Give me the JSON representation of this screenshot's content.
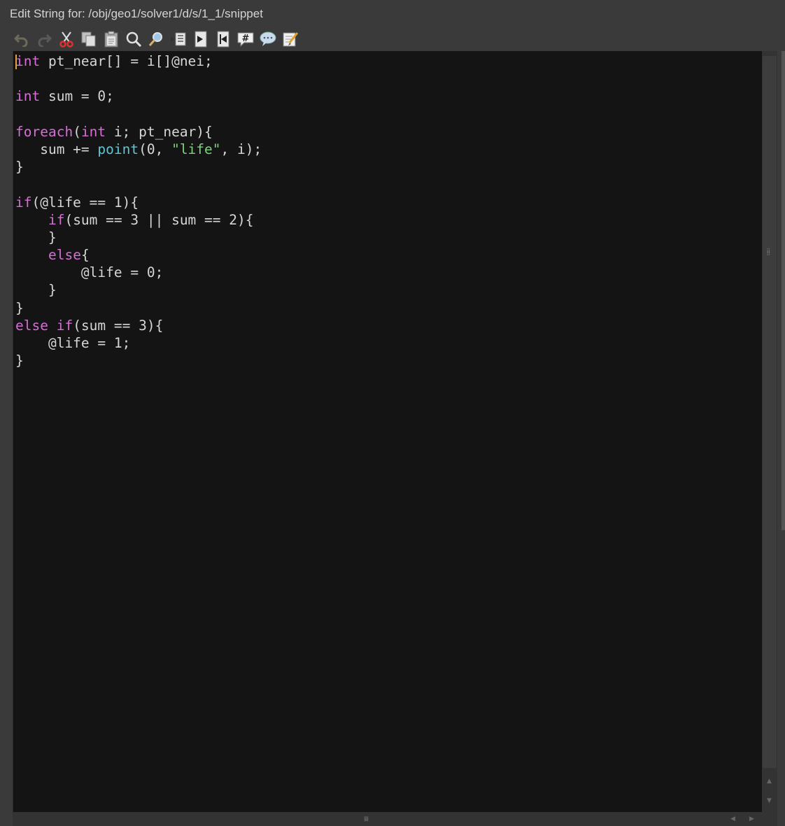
{
  "window": {
    "title": "Edit String for: /obj/geo1/solver1/d/s/1_1/snippet"
  },
  "toolbar": {
    "buttons": [
      {
        "name": "undo",
        "icon": "undo-icon"
      },
      {
        "name": "redo",
        "icon": "redo-icon"
      },
      {
        "name": "cut",
        "icon": "scissors-icon"
      },
      {
        "name": "copy",
        "icon": "copy-icon"
      },
      {
        "name": "paste",
        "icon": "paste-icon"
      },
      {
        "name": "find",
        "icon": "magnifier-icon"
      },
      {
        "name": "replace",
        "icon": "find-replace-icon"
      },
      {
        "name": "indent",
        "icon": "indent-icon"
      },
      {
        "name": "goto-next",
        "icon": "page-arrow-right-icon"
      },
      {
        "name": "goto-prev",
        "icon": "page-arrow-left-icon"
      },
      {
        "name": "comment",
        "icon": "comment-hash-icon"
      },
      {
        "name": "uncomment",
        "icon": "speech-bubble-icon"
      },
      {
        "name": "external-editor",
        "icon": "notepad-pencil-icon"
      }
    ]
  },
  "colors": {
    "keyword": "#d46fd4",
    "function": "#5fc6d4",
    "string": "#7ed07e",
    "text": "#d6d6d6",
    "background": "#141414",
    "caret": "#e8a040"
  },
  "editor": {
    "lines": [
      [
        {
          "t": "kw",
          "v": "int"
        },
        {
          "t": "tx",
          "v": " pt_near[] = i[]@nei;"
        }
      ],
      [],
      [
        {
          "t": "kw",
          "v": "int"
        },
        {
          "t": "tx",
          "v": " sum = 0;"
        }
      ],
      [],
      [
        {
          "t": "kw",
          "v": "foreach"
        },
        {
          "t": "tx",
          "v": "("
        },
        {
          "t": "kw",
          "v": "int"
        },
        {
          "t": "tx",
          "v": " i; pt_near){"
        }
      ],
      [
        {
          "t": "tx",
          "v": "   sum += "
        },
        {
          "t": "fn",
          "v": "point"
        },
        {
          "t": "tx",
          "v": "(0, "
        },
        {
          "t": "str",
          "v": "\"life\""
        },
        {
          "t": "tx",
          "v": ", i);"
        }
      ],
      [
        {
          "t": "tx",
          "v": "}"
        }
      ],
      [],
      [
        {
          "t": "kw",
          "v": "if"
        },
        {
          "t": "tx",
          "v": "(@life == 1){"
        }
      ],
      [
        {
          "t": "tx",
          "v": "    "
        },
        {
          "t": "kw",
          "v": "if"
        },
        {
          "t": "tx",
          "v": "(sum == 3 || sum == 2){"
        }
      ],
      [
        {
          "t": "tx",
          "v": "    }"
        }
      ],
      [
        {
          "t": "tx",
          "v": "    "
        },
        {
          "t": "kw",
          "v": "else"
        },
        {
          "t": "tx",
          "v": "{"
        }
      ],
      [
        {
          "t": "tx",
          "v": "        @life = 0;"
        }
      ],
      [
        {
          "t": "tx",
          "v": "    }"
        }
      ],
      [
        {
          "t": "tx",
          "v": "}"
        }
      ],
      [
        {
          "t": "kw",
          "v": "else"
        },
        {
          "t": "tx",
          "v": " "
        },
        {
          "t": "kw",
          "v": "if"
        },
        {
          "t": "tx",
          "v": "(sum == 3){"
        }
      ],
      [
        {
          "t": "tx",
          "v": "    @life = 1;"
        }
      ],
      [
        {
          "t": "tx",
          "v": "}"
        }
      ]
    ]
  }
}
